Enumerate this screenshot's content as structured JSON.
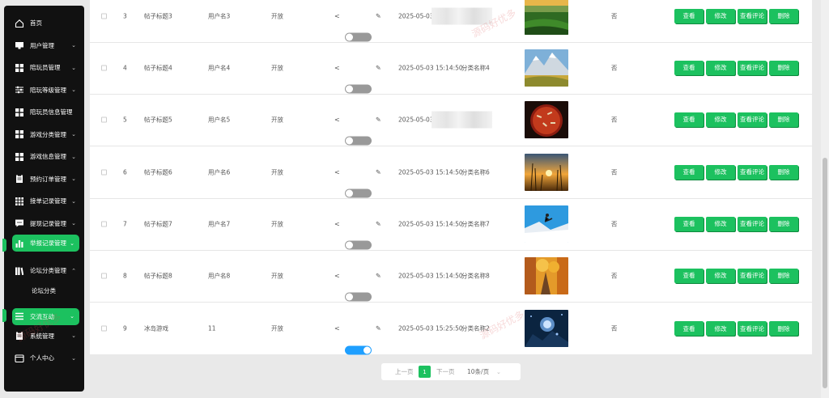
{
  "sidebar": {
    "items": [
      {
        "label": "首页",
        "icon": "home-icon",
        "chevron": false
      },
      {
        "label": "用户管理",
        "icon": "monitor-icon",
        "chevron": true
      },
      {
        "label": "陪玩员管理",
        "icon": "grid-icon",
        "chevron": true
      },
      {
        "label": "陪玩等级管理",
        "icon": "sliders-icon",
        "chevron": true
      },
      {
        "label": "陪玩员信息管理",
        "icon": "grid-icon",
        "chevron": false
      },
      {
        "label": "游戏分类管理",
        "icon": "grid-icon",
        "chevron": true
      },
      {
        "label": "游戏信息管理",
        "icon": "grid-icon",
        "chevron": true
      },
      {
        "label": "预约订单管理",
        "icon": "clipboard-icon",
        "chevron": true
      },
      {
        "label": "接单记录管理",
        "icon": "apps-icon",
        "chevron": true
      },
      {
        "label": "提现记录管理",
        "icon": "chat-icon",
        "chevron": true
      },
      {
        "label": "举报记录管理",
        "icon": "bar-chart-icon",
        "chevron": true,
        "active": true
      },
      {
        "label": "论坛分类管理",
        "icon": "books-icon",
        "chevron": true,
        "expanded": true
      },
      {
        "label": "论坛分类",
        "sub": true
      },
      {
        "label": "交流互动",
        "icon": "menu-icon",
        "chevron": true,
        "active": true
      },
      {
        "label": "系统管理",
        "icon": "clipboard-icon",
        "chevron": true
      },
      {
        "label": "个人中心",
        "icon": "wallet-icon",
        "chevron": true
      }
    ]
  },
  "table": {
    "rows": [
      {
        "index": "3",
        "title": "帖子标题3",
        "user": "用户名3",
        "status": "开放",
        "toggle_on": false,
        "time": "2025-05-03",
        "category": "",
        "blurred": true,
        "top": "否",
        "image": "green-field"
      },
      {
        "index": "4",
        "title": "帖子标题4",
        "user": "用户名4",
        "status": "开放",
        "toggle_on": false,
        "time": "2025-05-03 15:14:50",
        "category": "分类名称4",
        "blurred": false,
        "top": "否",
        "image": "mountains"
      },
      {
        "index": "5",
        "title": "帖子标题5",
        "user": "用户名5",
        "status": "开放",
        "toggle_on": false,
        "time": "2025-05-03",
        "category": "",
        "blurred": true,
        "top": "否",
        "image": "pizza"
      },
      {
        "index": "6",
        "title": "帖子标题6",
        "user": "用户名6",
        "status": "开放",
        "toggle_on": false,
        "time": "2025-05-03 15:14:50",
        "category": "分类名称6",
        "blurred": false,
        "top": "否",
        "image": "sunset-grass"
      },
      {
        "index": "7",
        "title": "帖子标题7",
        "user": "用户名7",
        "status": "开放",
        "toggle_on": false,
        "time": "2025-05-03 15:14:50",
        "category": "分类名称7",
        "blurred": false,
        "top": "否",
        "image": "skier"
      },
      {
        "index": "8",
        "title": "帖子标题8",
        "user": "用户名8",
        "status": "开放",
        "toggle_on": false,
        "time": "2025-05-03 15:14:50",
        "category": "分类名称8",
        "blurred": false,
        "top": "否",
        "image": "autumn-street"
      },
      {
        "index": "9",
        "title": "冰岛游戏",
        "user": "11",
        "status": "开放",
        "toggle_on": true,
        "time": "2025-05-03 15:25:50",
        "category": "分类名称2",
        "blurred": false,
        "top": "否",
        "image": "game-scene"
      }
    ],
    "actions": {
      "view": "查看",
      "edit": "修改",
      "comments": "查看评论",
      "delete": "删除"
    }
  },
  "pagination": {
    "prev": "上一页",
    "current": "1",
    "next": "下一页",
    "page_size": "10条/页"
  },
  "watermark": "源码好优多",
  "colors": {
    "accent": "#1cc15f",
    "toggle_on": "#1e9fff",
    "sidebar_bg": "#111111"
  }
}
